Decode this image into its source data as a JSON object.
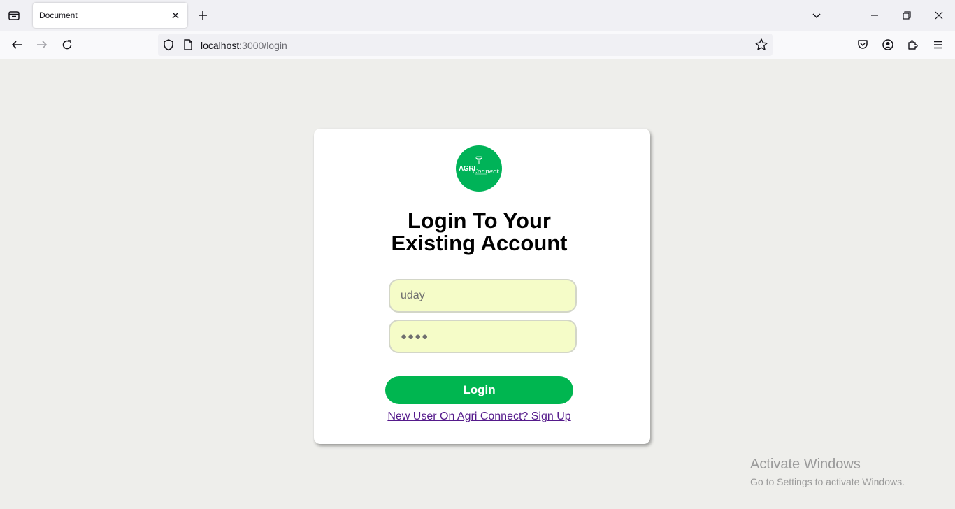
{
  "browser": {
    "tab_title": "Document",
    "url_host": "localhost",
    "url_path": ":3000/login"
  },
  "icons": {
    "tab_list": "tab-list-icon",
    "close_tab": "close-icon",
    "new_tab": "plus-icon",
    "back": "arrow-left-icon",
    "forward": "arrow-right-icon",
    "reload": "reload-icon",
    "shield": "shield-icon",
    "page": "page-icon",
    "bookmark": "star-icon",
    "pocket": "pocket-icon",
    "account": "account-icon",
    "extensions": "puzzle-icon",
    "menu": "hamburger-icon"
  },
  "login": {
    "logo_line1": "AGRI",
    "logo_line2": "Connect",
    "heading_line1": "Login To Your",
    "heading_line2": "Existing Account",
    "username_value": "uday",
    "password_display": "●●●●",
    "login_button": "Login",
    "signup_link": "New User On Agri Connect? Sign Up"
  },
  "watermark": {
    "title": "Activate Windows",
    "subtitle": "Go to Settings to activate Windows."
  },
  "colors": {
    "brand_green": "#00b650",
    "field_bg": "#f5fcc8",
    "link_purple": "#551a8b"
  }
}
